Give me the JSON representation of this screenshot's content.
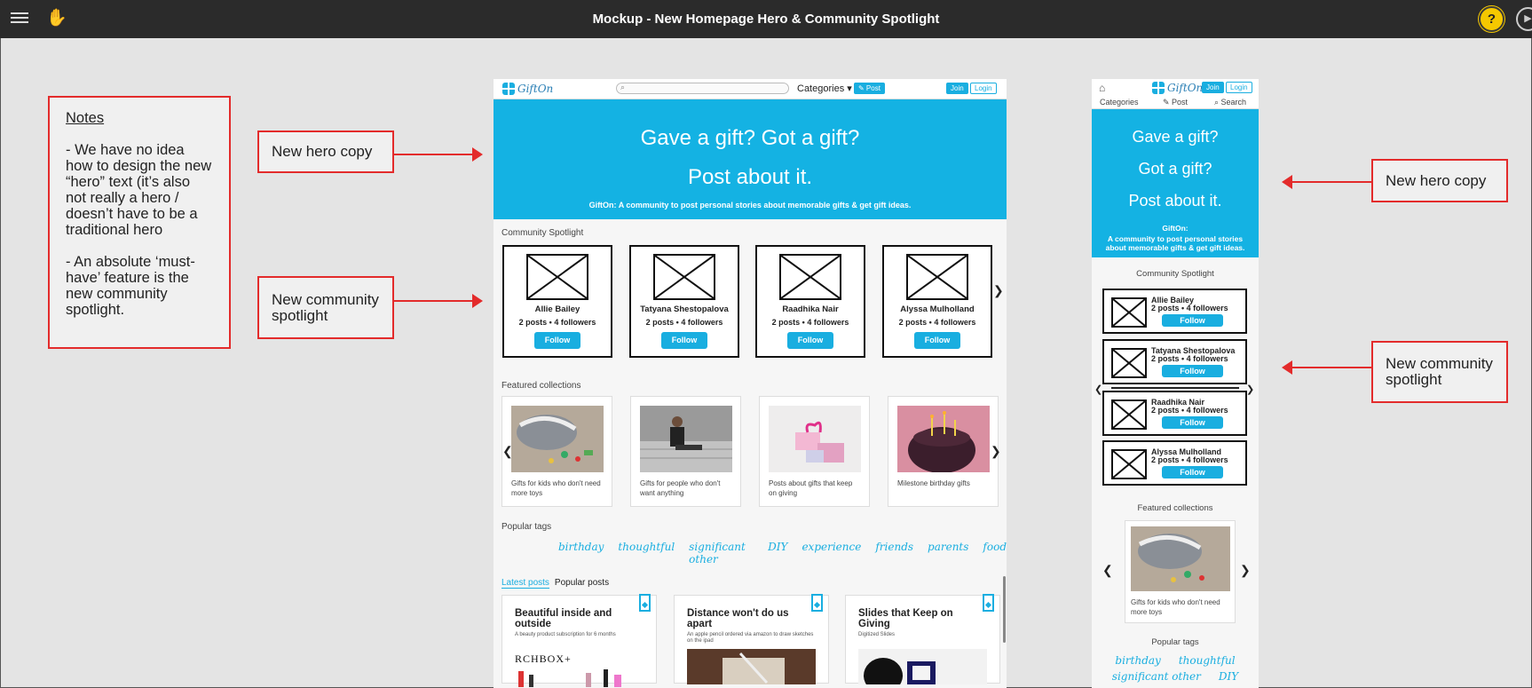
{
  "app": {
    "title": "Mockup - New Homepage Hero & Community Spotlight",
    "help_label": "?"
  },
  "notes": {
    "title": "Notes",
    "paragraphs": [
      "- We have no idea how to design the new “hero” text (it’s also not really a hero / doesn’t have to be a traditional hero",
      "- An absolute ‘must-have’ feature is the new community spotlight."
    ]
  },
  "callouts": {
    "hero": "New hero copy",
    "spotlight": "New community spotlight"
  },
  "site": {
    "logo": "GiftOn",
    "categories": "Categories ▾",
    "post": "✎ Post",
    "join": "Join",
    "login": "Login",
    "hero_lines": [
      "Gave a gift? Got a gift?",
      "Post about it."
    ],
    "hero_sub": "GiftOn: A community to post personal stories about memorable gifts & get gift ideas.",
    "spotlight_label": "Community Spotlight",
    "spotlight": [
      {
        "name": "Allie Bailey",
        "stats": "2 posts • 4 followers"
      },
      {
        "name": "Tatyana Shestopalova",
        "stats": "2 posts • 4 followers"
      },
      {
        "name": "Raadhika Nair",
        "stats": "2 posts • 4 followers"
      },
      {
        "name": "Alyssa Mulholland",
        "stats": "2 posts • 4 followers"
      }
    ],
    "follow": "Follow",
    "featured_label": "Featured collections",
    "featured": [
      "Gifts for kids who don't need more toys",
      "Gifts for people who don't want anything",
      "Posts about gifts that keep on giving",
      "Milestone birthday gifts"
    ],
    "tags_label": "Popular tags",
    "tags": [
      "birthday",
      "thoughtful",
      "significant other",
      "DIY",
      "experience",
      "friends",
      "parents",
      "food"
    ],
    "tabs": [
      "Latest posts",
      "Popular posts"
    ],
    "posts": [
      {
        "title": "Beautiful inside and outside",
        "sub": "A beauty product subscription for 6 months"
      },
      {
        "title": "Distance won't do us apart",
        "sub": "An apple pencil ordered via amazon to draw sketches on the ipad"
      },
      {
        "title": "Slides that Keep on Giving",
        "sub": "Digitized Slides"
      }
    ],
    "post_brand": "RCHBOX+"
  },
  "mobile": {
    "nav": {
      "categories": "Categories",
      "post": "✎ Post",
      "search": "⌕ Search"
    },
    "hero_lines": [
      "Gave a gift?",
      "Got a gift?",
      "Post about it."
    ],
    "hero_sub_lines": [
      "GiftOn:",
      "A community to post personal stories about memorable gifts & get gift ideas."
    ],
    "featured_caption": "Gifts for kids who don't need more toys",
    "tags": [
      "birthday",
      "thoughtful",
      "significant other",
      "DIY"
    ]
  },
  "colors": {
    "accent": "#14b2e3",
    "callout_border": "#e32b2b",
    "help": "#f5c800"
  }
}
